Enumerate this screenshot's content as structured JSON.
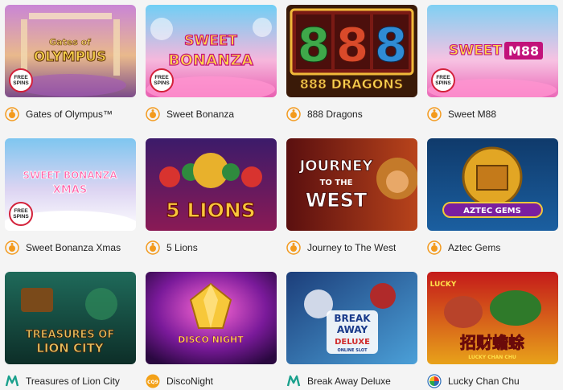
{
  "badge": {
    "line1": "FREE",
    "line2": "SPINS"
  },
  "games": [
    {
      "name": "Gates of Olympus™",
      "art_title_1": "Gates of",
      "art_title_2": "OLYMPUS",
      "provider": "pragmatic-play",
      "free_spins": true
    },
    {
      "name": "Sweet Bonanza",
      "art_title_1": "SWEET",
      "art_title_2": "BONANZA",
      "provider": "pragmatic-play",
      "free_spins": true
    },
    {
      "name": "888 Dragons",
      "art_title_1": "888 DRAGONS",
      "provider": "pragmatic-play",
      "free_spins": false
    },
    {
      "name": "Sweet M88",
      "art_title_1": "SWEET",
      "art_title_2": "M88",
      "provider": "pragmatic-play",
      "free_spins": true
    },
    {
      "name": "Sweet Bonanza Xmas",
      "art_title_1": "SWEET BONANZA",
      "art_title_2": "XMAS",
      "provider": "pragmatic-play",
      "free_spins": true
    },
    {
      "name": "5 Lions",
      "art_title_1": "5 LIONS",
      "provider": "pragmatic-play",
      "free_spins": false
    },
    {
      "name": "Journey to The West",
      "art_title_1": "JOURNEY",
      "art_title_2": "TO THE",
      "art_title_3": "WEST",
      "provider": "pragmatic-play",
      "free_spins": false
    },
    {
      "name": "Aztec Gems",
      "art_title_1": "AZTEC GEMS",
      "provider": "pragmatic-play",
      "free_spins": false
    },
    {
      "name": "Treasures of Lion City",
      "art_title_1": "TREASURES OF",
      "art_title_2": "LION CITY",
      "provider": "microgaming",
      "free_spins": false
    },
    {
      "name": "DiscoNight",
      "art_title_1": "DISCO NIGHT",
      "provider": "cq9",
      "free_spins": false
    },
    {
      "name": "Break Away Deluxe",
      "art_title_1": "BREAK",
      "art_title_2": "AWAY",
      "art_title_3": "DELUXE",
      "art_title_4": "ONLINE SLOT",
      "provider": "microgaming",
      "free_spins": false
    },
    {
      "name": "Lucky Chan Chu",
      "art_title_1": "招财蟾蜍",
      "art_title_2": "LUCKY CHAN CHU",
      "art_title_3": "LUCKY",
      "provider": "spadegaming",
      "free_spins": false
    }
  ],
  "colors": {
    "pragmatic": "#f39a1d",
    "microgaming": "#1aa08c",
    "cq9": "#f3a118",
    "badge_ring": "#d3213a"
  }
}
